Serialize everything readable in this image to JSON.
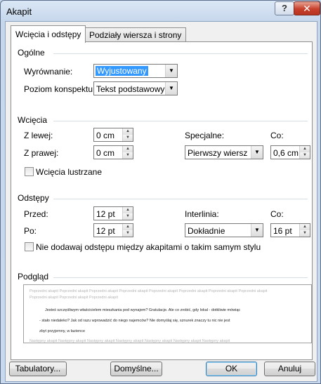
{
  "window": {
    "title": "Akapit",
    "help": "?",
    "close": "✕"
  },
  "tabs": [
    {
      "label": "Wcięcia i odstępy",
      "active": true
    },
    {
      "label": "Podziały wiersza i strony",
      "active": false
    }
  ],
  "general": {
    "title": "Ogólne",
    "alignment_label": "Wyrównanie:",
    "alignment_value": "Wyjustowany",
    "outline_label": "Poziom konspektu:",
    "outline_value": "Tekst podstawowy"
  },
  "indents": {
    "title": "Wcięcia",
    "left_label": "Z lewej:",
    "left_value": "0 cm",
    "right_label": "Z prawej:",
    "right_value": "0 cm",
    "special_label": "Specjalne:",
    "special_value": "Pierwszy wiersz",
    "by_label": "Co:",
    "by_value": "0,6 cm",
    "mirror_label": "Wcięcia lustrzane",
    "mirror_checked": false
  },
  "spacing": {
    "title": "Odstępy",
    "before_label": "Przed:",
    "before_value": "12 pt",
    "after_label": "Po:",
    "after_value": "12 pt",
    "line_label": "Interlinia:",
    "line_value": "Dokładnie",
    "at_label": "Co:",
    "at_value": "16 pt",
    "dont_add_label": "Nie dodawaj odstępu między akapitami o takim samym stylu",
    "dont_add_checked": false
  },
  "preview": {
    "title": "Podgląd",
    "prev_line1": "Poprzedni akapit Poprzedni akapit Poprzedni akapit Poprzedni akapit Poprzedni akapit Poprzedni akapit Poprzedni akapit Poprzedni akapit",
    "prev_line2": "Poprzedni akapit Poprzedni akapit Poprzedni akapit",
    "body_line1": "Jesteś szczęśliwym właścicielem mieszkania pod wynajem? Gratulacje. Ale co zrobić, gdy lokal - dotkliwie mówiąc",
    "body_line2": "- stało niedaleko? Jak od razu wprowadzić do niego najemców? Nie domyślaj się, sznurek znaczy tu nic nie jest",
    "body_line3": "zbyt przyjemny, w łazience",
    "next_line": "Następny akapit Następny akapit Następny akapit Następny akapit Następny akapit Następny akapit Następny akapit"
  },
  "buttons": {
    "tabs": "Tabulatory...",
    "default": "Domyślne...",
    "ok": "OK",
    "cancel": "Anuluj"
  }
}
